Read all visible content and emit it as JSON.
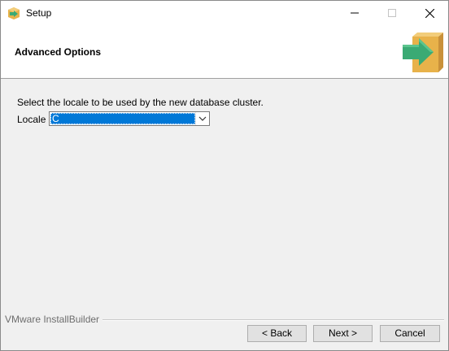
{
  "window": {
    "title": "Setup",
    "app_icon": "installer-box-icon",
    "controls": {
      "minimize_icon": "minimize-icon",
      "maximize_icon": "maximize-icon",
      "close_icon": "close-icon"
    }
  },
  "header": {
    "title": "Advanced Options",
    "logo_icon": "installer-box-arrow-icon"
  },
  "content": {
    "instruction": "Select the locale to be used by the new database cluster.",
    "locale": {
      "label": "Locale",
      "selected_value": "C",
      "dropdown_icon": "chevron-down-icon"
    }
  },
  "footer": {
    "brand": "VMware InstallBuilder",
    "buttons": {
      "back": "< Back",
      "next": "Next >",
      "cancel": "Cancel"
    }
  },
  "colors": {
    "selection": "#0078d7",
    "arrow_green": "#3aaa74",
    "box_tan": "#e8b24a"
  }
}
